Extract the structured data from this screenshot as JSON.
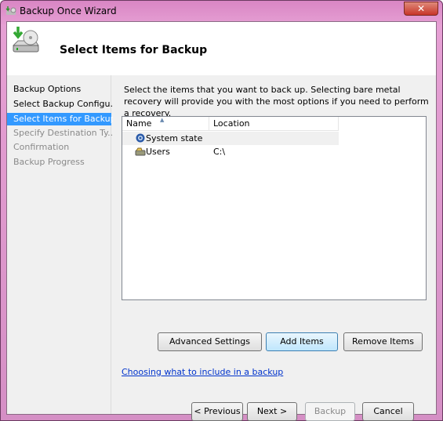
{
  "window": {
    "title": "Backup Once Wizard",
    "close_label": "✕"
  },
  "header": {
    "title": "Select Items for Backup"
  },
  "nav": {
    "items": [
      {
        "label": "Backup Options",
        "state": "done"
      },
      {
        "label": "Select Backup Configu...",
        "state": "done"
      },
      {
        "label": "Select Items for Backup",
        "state": "selected"
      },
      {
        "label": "Specify Destination Ty...",
        "state": "pending"
      },
      {
        "label": "Confirmation",
        "state": "pending"
      },
      {
        "label": "Backup Progress",
        "state": "pending"
      }
    ]
  },
  "main": {
    "description": "Select the items that you want to back up. Selecting bare metal recovery will provide you with the most options if you need to perform a recovery.",
    "list": {
      "columns": [
        "Name",
        "Location"
      ],
      "rows": [
        {
          "name": "System state",
          "location": "",
          "icon": "system-state-icon"
        },
        {
          "name": "Users",
          "location": "C:\\",
          "icon": "folder-drive-icon"
        }
      ]
    },
    "buttons": {
      "advanced": "Advanced Settings",
      "add": "Add Items",
      "remove": "Remove Items"
    },
    "help_link": "Choosing what to include in a backup"
  },
  "footer": {
    "previous": "< Previous",
    "next": "Next >",
    "backup": "Backup",
    "cancel": "Cancel"
  },
  "colors": {
    "selection": "#3399ff",
    "link": "#0033cc",
    "frame": "#d986c4"
  }
}
